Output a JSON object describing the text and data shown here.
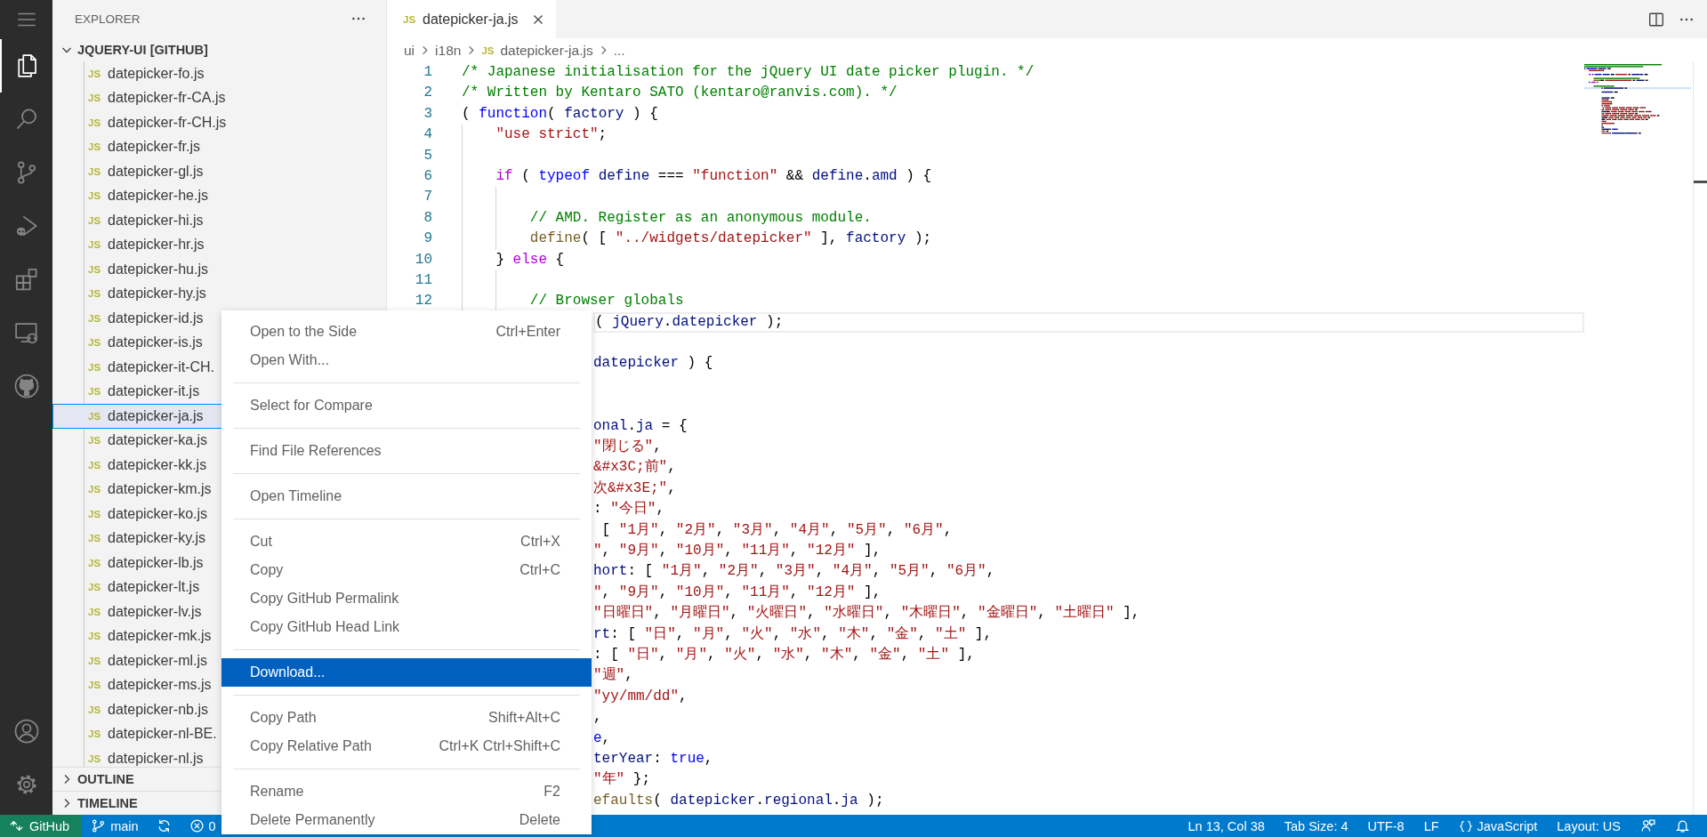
{
  "activity_bar": {
    "items": [
      {
        "kind": "explorer",
        "selected": true
      },
      {
        "kind": "search",
        "selected": false
      },
      {
        "kind": "source-control",
        "selected": false
      },
      {
        "kind": "run-debug",
        "selected": false
      },
      {
        "kind": "extensions",
        "selected": false
      },
      {
        "kind": "remote-explorer",
        "selected": false
      },
      {
        "kind": "github",
        "selected": false
      }
    ],
    "bottom_items": [
      {
        "kind": "account"
      },
      {
        "kind": "settings"
      }
    ]
  },
  "sidebar": {
    "title": "EXPLORER",
    "section": {
      "title": "JQUERY-UI [GITHUB]",
      "expanded": true,
      "files": [
        {
          "badge": "JS",
          "name": "datepicker-fo.js",
          "selected": false
        },
        {
          "badge": "JS",
          "name": "datepicker-fr-CA.js",
          "selected": false
        },
        {
          "badge": "JS",
          "name": "datepicker-fr-CH.js",
          "selected": false
        },
        {
          "badge": "JS",
          "name": "datepicker-fr.js",
          "selected": false
        },
        {
          "badge": "JS",
          "name": "datepicker-gl.js",
          "selected": false
        },
        {
          "badge": "JS",
          "name": "datepicker-he.js",
          "selected": false
        },
        {
          "badge": "JS",
          "name": "datepicker-hi.js",
          "selected": false
        },
        {
          "badge": "JS",
          "name": "datepicker-hr.js",
          "selected": false
        },
        {
          "badge": "JS",
          "name": "datepicker-hu.js",
          "selected": false
        },
        {
          "badge": "JS",
          "name": "datepicker-hy.js",
          "selected": false
        },
        {
          "badge": "JS",
          "name": "datepicker-id.js",
          "selected": false
        },
        {
          "badge": "JS",
          "name": "datepicker-is.js",
          "selected": false
        },
        {
          "badge": "JS",
          "name": "datepicker-it-CH.",
          "selected": false
        },
        {
          "badge": "JS",
          "name": "datepicker-it.js",
          "selected": false
        },
        {
          "badge": "JS",
          "name": "datepicker-ja.js",
          "selected": true
        },
        {
          "badge": "JS",
          "name": "datepicker-ka.js",
          "selected": false
        },
        {
          "badge": "JS",
          "name": "datepicker-kk.js",
          "selected": false
        },
        {
          "badge": "JS",
          "name": "datepicker-km.js",
          "selected": false
        },
        {
          "badge": "JS",
          "name": "datepicker-ko.js",
          "selected": false
        },
        {
          "badge": "JS",
          "name": "datepicker-ky.js",
          "selected": false
        },
        {
          "badge": "JS",
          "name": "datepicker-lb.js",
          "selected": false
        },
        {
          "badge": "JS",
          "name": "datepicker-lt.js",
          "selected": false
        },
        {
          "badge": "JS",
          "name": "datepicker-lv.js",
          "selected": false
        },
        {
          "badge": "JS",
          "name": "datepicker-mk.js",
          "selected": false
        },
        {
          "badge": "JS",
          "name": "datepicker-ml.js",
          "selected": false
        },
        {
          "badge": "JS",
          "name": "datepicker-ms.js",
          "selected": false
        },
        {
          "badge": "JS",
          "name": "datepicker-nb.js",
          "selected": false
        },
        {
          "badge": "JS",
          "name": "datepicker-nl-BE.",
          "selected": false
        },
        {
          "badge": "JS",
          "name": "datepicker-nl.js",
          "selected": false
        }
      ]
    },
    "collapsed_sections": [
      {
        "title": "OUTLINE",
        "expanded": false
      },
      {
        "title": "TIMELINE",
        "expanded": false
      }
    ]
  },
  "editor": {
    "tabs": [
      {
        "badge": "JS",
        "title": "datepicker-ja.js",
        "selected": true
      }
    ],
    "breadcrumbs": [
      {
        "text": "ui"
      },
      {
        "text": "i18n"
      },
      {
        "badge": "JS",
        "text": "datepicker-ja.js"
      },
      {
        "text": "..."
      }
    ],
    "lines": [
      {
        "kind": "numbered",
        "number": "1",
        "current": false,
        "segments": [
          {
            "comment": "/* Japanese initialisation for the jQuery UI date picker plugin. */"
          }
        ]
      },
      {
        "kind": "numbered",
        "number": "2",
        "current": false,
        "segments": [
          {
            "comment": "/* Written by Kentaro SATO (kentaro@ranvis.com). */"
          }
        ]
      },
      {
        "kind": "numbered",
        "number": "3",
        "current": false,
        "segments": [
          {
            "plain": "( "
          },
          {
            "storage": "function"
          },
          {
            "plain": "( "
          },
          {
            "variable": "factory"
          },
          {
            "plain": " ) {"
          }
        ],
        "children": [
          {
            "kind": "numbered",
            "number": "4",
            "current": false,
            "segments": [
              {
                "string": "\"use strict\""
              },
              {
                "plain": ";"
              }
            ]
          },
          {
            "kind": "numbered",
            "number": "5",
            "current": false
          },
          {
            "kind": "numbered",
            "number": "6",
            "current": false,
            "segments": [
              {
                "keyword": "if"
              },
              {
                "plain": " ( "
              },
              {
                "storage": "typeof "
              },
              {
                "variable": "define"
              },
              {
                "plain": " === "
              },
              {
                "string": "\"function\""
              },
              {
                "plain": " && "
              },
              {
                "variable": "define"
              },
              {
                "plain": "."
              },
              {
                "variable": "amd"
              },
              {
                "plain": " ) {"
              }
            ],
            "children": [
              {
                "kind": "numbered",
                "number": "7",
                "current": false
              },
              {
                "kind": "numbered",
                "number": "8",
                "current": false,
                "segments": [
                  {
                    "comment": "// AMD. Register as an anonymous module."
                  }
                ]
              },
              {
                "kind": "numbered",
                "number": "9",
                "current": false,
                "segments": [
                  {
                    "function": "define"
                  },
                  {
                    "plain": "( [ "
                  },
                  {
                    "string": "\"../widgets/datepicker\""
                  },
                  {
                    "plain": " ], "
                  },
                  {
                    "variable": "factory"
                  },
                  {
                    "plain": " );"
                  }
                ]
              }
            ]
          },
          {
            "kind": "numbered",
            "number": "10",
            "current": false,
            "segments": [
              {
                "plain": "} "
              },
              {
                "keyword": "else"
              },
              {
                "plain": " {"
              }
            ],
            "children": [
              {
                "kind": "numbered",
                "number": "11",
                "current": false
              },
              {
                "kind": "numbered",
                "number": "12",
                "current": false,
                "segments": [
                  {
                    "comment": "// Browser globals"
                  }
                ]
              }
            ]
          }
        ]
      },
      {
        "kind": "covered",
        "current": true,
        "segments": [
          {
            "plain": "( "
          },
          {
            "variable": "jQuery"
          },
          {
            "plain": "."
          },
          {
            "variable": "datepicker"
          },
          {
            "plain": " );"
          }
        ]
      },
      {
        "kind": "covered",
        "current": false
      },
      {
        "kind": "covered",
        "current": false,
        "segments": [
          {
            "variable": "datepicker"
          },
          {
            "plain": " ) {"
          }
        ]
      },
      {
        "kind": "covered",
        "current": false
      },
      {
        "kind": "covered",
        "current": false
      },
      {
        "kind": "covered",
        "current": false,
        "segments": [
          {
            "variable": "onal"
          },
          {
            "plain": "."
          },
          {
            "variable": "ja"
          },
          {
            "plain": " = {"
          }
        ]
      },
      {
        "kind": "covered",
        "current": false,
        "segments": [
          {
            "string": "\"閉じる\""
          },
          {
            "plain": ","
          }
        ]
      },
      {
        "kind": "covered",
        "current": false,
        "segments": [
          {
            "string": "&#x3C;前\""
          },
          {
            "plain": ","
          }
        ]
      },
      {
        "kind": "covered",
        "current": false,
        "segments": [
          {
            "string": "次&#x3E;\""
          },
          {
            "plain": ","
          }
        ]
      },
      {
        "kind": "covered",
        "current": false,
        "segments": [
          {
            "plain": ": "
          },
          {
            "string": "\"今日\""
          },
          {
            "plain": ","
          }
        ]
      },
      {
        "kind": "covered",
        "current": false,
        "segments": [
          {
            "plain": " [ "
          },
          {
            "string": "\"1月\""
          },
          {
            "plain": ", "
          },
          {
            "string": "\"2月\""
          },
          {
            "plain": ", "
          },
          {
            "string": "\"3月\""
          },
          {
            "plain": ", "
          },
          {
            "string": "\"4月\""
          },
          {
            "plain": ", "
          },
          {
            "string": "\"5月\""
          },
          {
            "plain": ", "
          },
          {
            "string": "\"6月\""
          },
          {
            "plain": ","
          }
        ]
      },
      {
        "kind": "covered",
        "current": false,
        "segments": [
          {
            "string": "\""
          },
          {
            "plain": ", "
          },
          {
            "string": "\"9月\""
          },
          {
            "plain": ", "
          },
          {
            "string": "\"10月\""
          },
          {
            "plain": ", "
          },
          {
            "string": "\"11月\""
          },
          {
            "plain": ", "
          },
          {
            "string": "\"12月\""
          },
          {
            "plain": " ],"
          }
        ]
      },
      {
        "kind": "covered",
        "current": false,
        "segments": [
          {
            "variable": "hort"
          },
          {
            "plain": ": [ "
          },
          {
            "string": "\"1月\""
          },
          {
            "plain": ", "
          },
          {
            "string": "\"2月\""
          },
          {
            "plain": ", "
          },
          {
            "string": "\"3月\""
          },
          {
            "plain": ", "
          },
          {
            "string": "\"4月\""
          },
          {
            "plain": ", "
          },
          {
            "string": "\"5月\""
          },
          {
            "plain": ", "
          },
          {
            "string": "\"6月\""
          },
          {
            "plain": ","
          }
        ]
      },
      {
        "kind": "covered",
        "current": false,
        "segments": [
          {
            "string": "\""
          },
          {
            "plain": ", "
          },
          {
            "string": "\"9月\""
          },
          {
            "plain": ", "
          },
          {
            "string": "\"10月\""
          },
          {
            "plain": ", "
          },
          {
            "string": "\"11月\""
          },
          {
            "plain": ", "
          },
          {
            "string": "\"12月\""
          },
          {
            "plain": " ],"
          }
        ]
      },
      {
        "kind": "covered",
        "current": false,
        "segments": [
          {
            "string": "\"日曜日\""
          },
          {
            "plain": ", "
          },
          {
            "string": "\"月曜日\""
          },
          {
            "plain": ", "
          },
          {
            "string": "\"火曜日\""
          },
          {
            "plain": ", "
          },
          {
            "string": "\"水曜日\""
          },
          {
            "plain": ", "
          },
          {
            "string": "\"木曜日\""
          },
          {
            "plain": ", "
          },
          {
            "string": "\"金曜日\""
          },
          {
            "plain": ", "
          },
          {
            "string": "\"土曜日\""
          },
          {
            "plain": " ],"
          }
        ]
      },
      {
        "kind": "covered",
        "current": false,
        "segments": [
          {
            "variable": "rt"
          },
          {
            "plain": ": [ "
          },
          {
            "string": "\"日\""
          },
          {
            "plain": ", "
          },
          {
            "string": "\"月\""
          },
          {
            "plain": ", "
          },
          {
            "string": "\"火\""
          },
          {
            "plain": ", "
          },
          {
            "string": "\"水\""
          },
          {
            "plain": ", "
          },
          {
            "string": "\"木\""
          },
          {
            "plain": ", "
          },
          {
            "string": "\"金\""
          },
          {
            "plain": ", "
          },
          {
            "string": "\"土\""
          },
          {
            "plain": " ],"
          }
        ]
      },
      {
        "kind": "covered",
        "current": false,
        "segments": [
          {
            "plain": ": [ "
          },
          {
            "string": "\"日\""
          },
          {
            "plain": ", "
          },
          {
            "string": "\"月\""
          },
          {
            "plain": ", "
          },
          {
            "string": "\"火\""
          },
          {
            "plain": ", "
          },
          {
            "string": "\"水\""
          },
          {
            "plain": ", "
          },
          {
            "string": "\"木\""
          },
          {
            "plain": ", "
          },
          {
            "string": "\"金\""
          },
          {
            "plain": ", "
          },
          {
            "string": "\"土\""
          },
          {
            "plain": " ],"
          }
        ]
      },
      {
        "kind": "covered",
        "current": false,
        "segments": [
          {
            "string": "\"週\""
          },
          {
            "plain": ","
          }
        ]
      },
      {
        "kind": "covered",
        "current": false,
        "segments": [
          {
            "string": "\"yy/mm/dd\""
          },
          {
            "plain": ","
          }
        ]
      },
      {
        "kind": "covered",
        "current": false,
        "segments": [
          {
            "plain": ","
          }
        ]
      },
      {
        "kind": "covered",
        "current": false,
        "segments": [
          {
            "storage": "e"
          },
          {
            "plain": ","
          }
        ]
      },
      {
        "kind": "covered",
        "current": false,
        "segments": [
          {
            "variable": "terYear"
          },
          {
            "plain": ": "
          },
          {
            "storage": "true"
          },
          {
            "plain": ","
          }
        ]
      },
      {
        "kind": "covered",
        "current": false,
        "segments": [
          {
            "string": "\"年\""
          },
          {
            "plain": " };"
          }
        ]
      },
      {
        "kind": "covered",
        "current": false,
        "segments": [
          {
            "function": "efaults"
          },
          {
            "plain": "( "
          },
          {
            "variable": "datepicker"
          },
          {
            "plain": "."
          },
          {
            "variable": "regional"
          },
          {
            "plain": "."
          },
          {
            "variable": "ja"
          },
          {
            "plain": " );"
          }
        ]
      }
    ]
  },
  "context_menu": {
    "groups": [
      {
        "items": [
          {
            "label": "Open to the Side",
            "shortcut": "Ctrl+Enter",
            "selected": false
          },
          {
            "label": "Open With...",
            "selected": false
          }
        ]
      },
      {
        "items": [
          {
            "label": "Select for Compare",
            "selected": false
          }
        ]
      },
      {
        "items": [
          {
            "label": "Find File References",
            "selected": false
          }
        ]
      },
      {
        "items": [
          {
            "label": "Open Timeline",
            "selected": false
          }
        ]
      },
      {
        "items": [
          {
            "label": "Cut",
            "shortcut": "Ctrl+X",
            "selected": false
          },
          {
            "label": "Copy",
            "shortcut": "Ctrl+C",
            "selected": false
          },
          {
            "label": "Copy GitHub Permalink",
            "selected": false
          },
          {
            "label": "Copy GitHub Head Link",
            "selected": false
          }
        ]
      },
      {
        "items": [
          {
            "label": "Download...",
            "selected": true
          }
        ]
      },
      {
        "items": [
          {
            "label": "Copy Path",
            "shortcut": "Shift+Alt+C",
            "selected": false
          },
          {
            "label": "Copy Relative Path",
            "shortcut": "Ctrl+K Ctrl+Shift+C",
            "selected": false
          }
        ]
      },
      {
        "items": [
          {
            "label": "Rename",
            "shortcut": "F2",
            "selected": false
          },
          {
            "label": "Delete Permanently",
            "shortcut": "Delete",
            "selected": false
          }
        ]
      }
    ]
  },
  "status_bar": {
    "remote": "GitHub",
    "branch": "main",
    "error_count": "0",
    "items": [
      {
        "kind": "text",
        "text": "Ln 13, Col 38"
      },
      {
        "kind": "text",
        "text": "Tab Size: 4"
      },
      {
        "kind": "text",
        "text": "UTF-8"
      },
      {
        "kind": "text",
        "text": "LF"
      },
      {
        "kind": "language",
        "text": "JavaScript"
      },
      {
        "kind": "text",
        "text": "Layout: US"
      },
      {
        "kind": "feedback"
      },
      {
        "kind": "notifications"
      }
    ]
  }
}
